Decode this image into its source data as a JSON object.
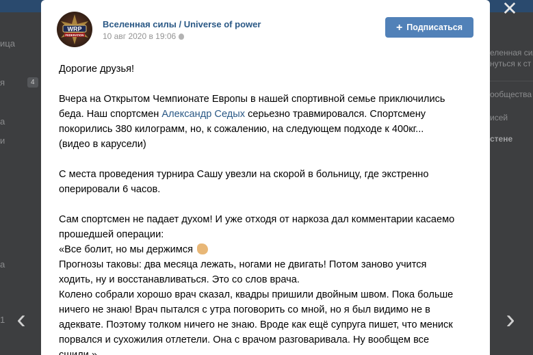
{
  "background": {
    "left_items": [
      "ица",
      "я",
      "а",
      "и",
      "а",
      "1"
    ],
    "left_badge": "4",
    "right_items": [
      "еленная сил",
      "нуться к ст",
      "ообщества",
      "исей",
      "стене"
    ]
  },
  "nav": {
    "close_label": "✕",
    "prev_label": "‹",
    "next_label": "›"
  },
  "post": {
    "group_name": "Вселенная силы / Universe of power",
    "date": "10 авг 2020 в 19:06",
    "subscribe_label": "Подписаться",
    "lines": {
      "l1": "Дорогие друзья!",
      "l2": "Вчера на Открытом Чемпионате Европы в нашей спортивной семье приключились",
      "l3a": "беда. Наш спортсмен ",
      "l3link": "Александр Седых",
      "l3b": " серьезно травмировался. Спортсмену",
      "l4": "покорились 380 килограмм, но, к сожалению, на следующем подходе к 400кг...",
      "l5": "(видео в карусели)",
      "l6": "С места проведения турнира Сашу увезли на скорой в больницу, где экстренно",
      "l7": "оперировали 6 часов.",
      "l8": "Сам спортсмен не падает духом! И уже отходя от наркоза дал комментарии касаемо",
      "l9": "прошедшей операции:",
      "l10": "«Все болит, но мы держимся",
      "l11": "Прогнозы таковы: два месяца лежать, ногами не двигать! Потом заново учится",
      "l12": "ходить, ну и восстанавливаться. Это со слов врача.",
      "l13": "Колено собрали хорошо врач сказал, квадры пришили двойным швом. Пока больше",
      "l14": "ничего не знаю! Врач пытался с утра поговорить со мной, но я был видимо не в",
      "l15": "адеквате. Поэтому толком ничего не знаю. Вроде как ещё супруга пишет, что мениск",
      "l16": "порвался и сухожилия отлетели. Она с врачом разговаривала. Ну вообщем все",
      "l17": "сшили.»"
    }
  },
  "avatar_text": "WRP",
  "avatar_sub": "FEDERATION",
  "colors": {
    "accent": "#5181b8",
    "link": "#2a5885"
  }
}
